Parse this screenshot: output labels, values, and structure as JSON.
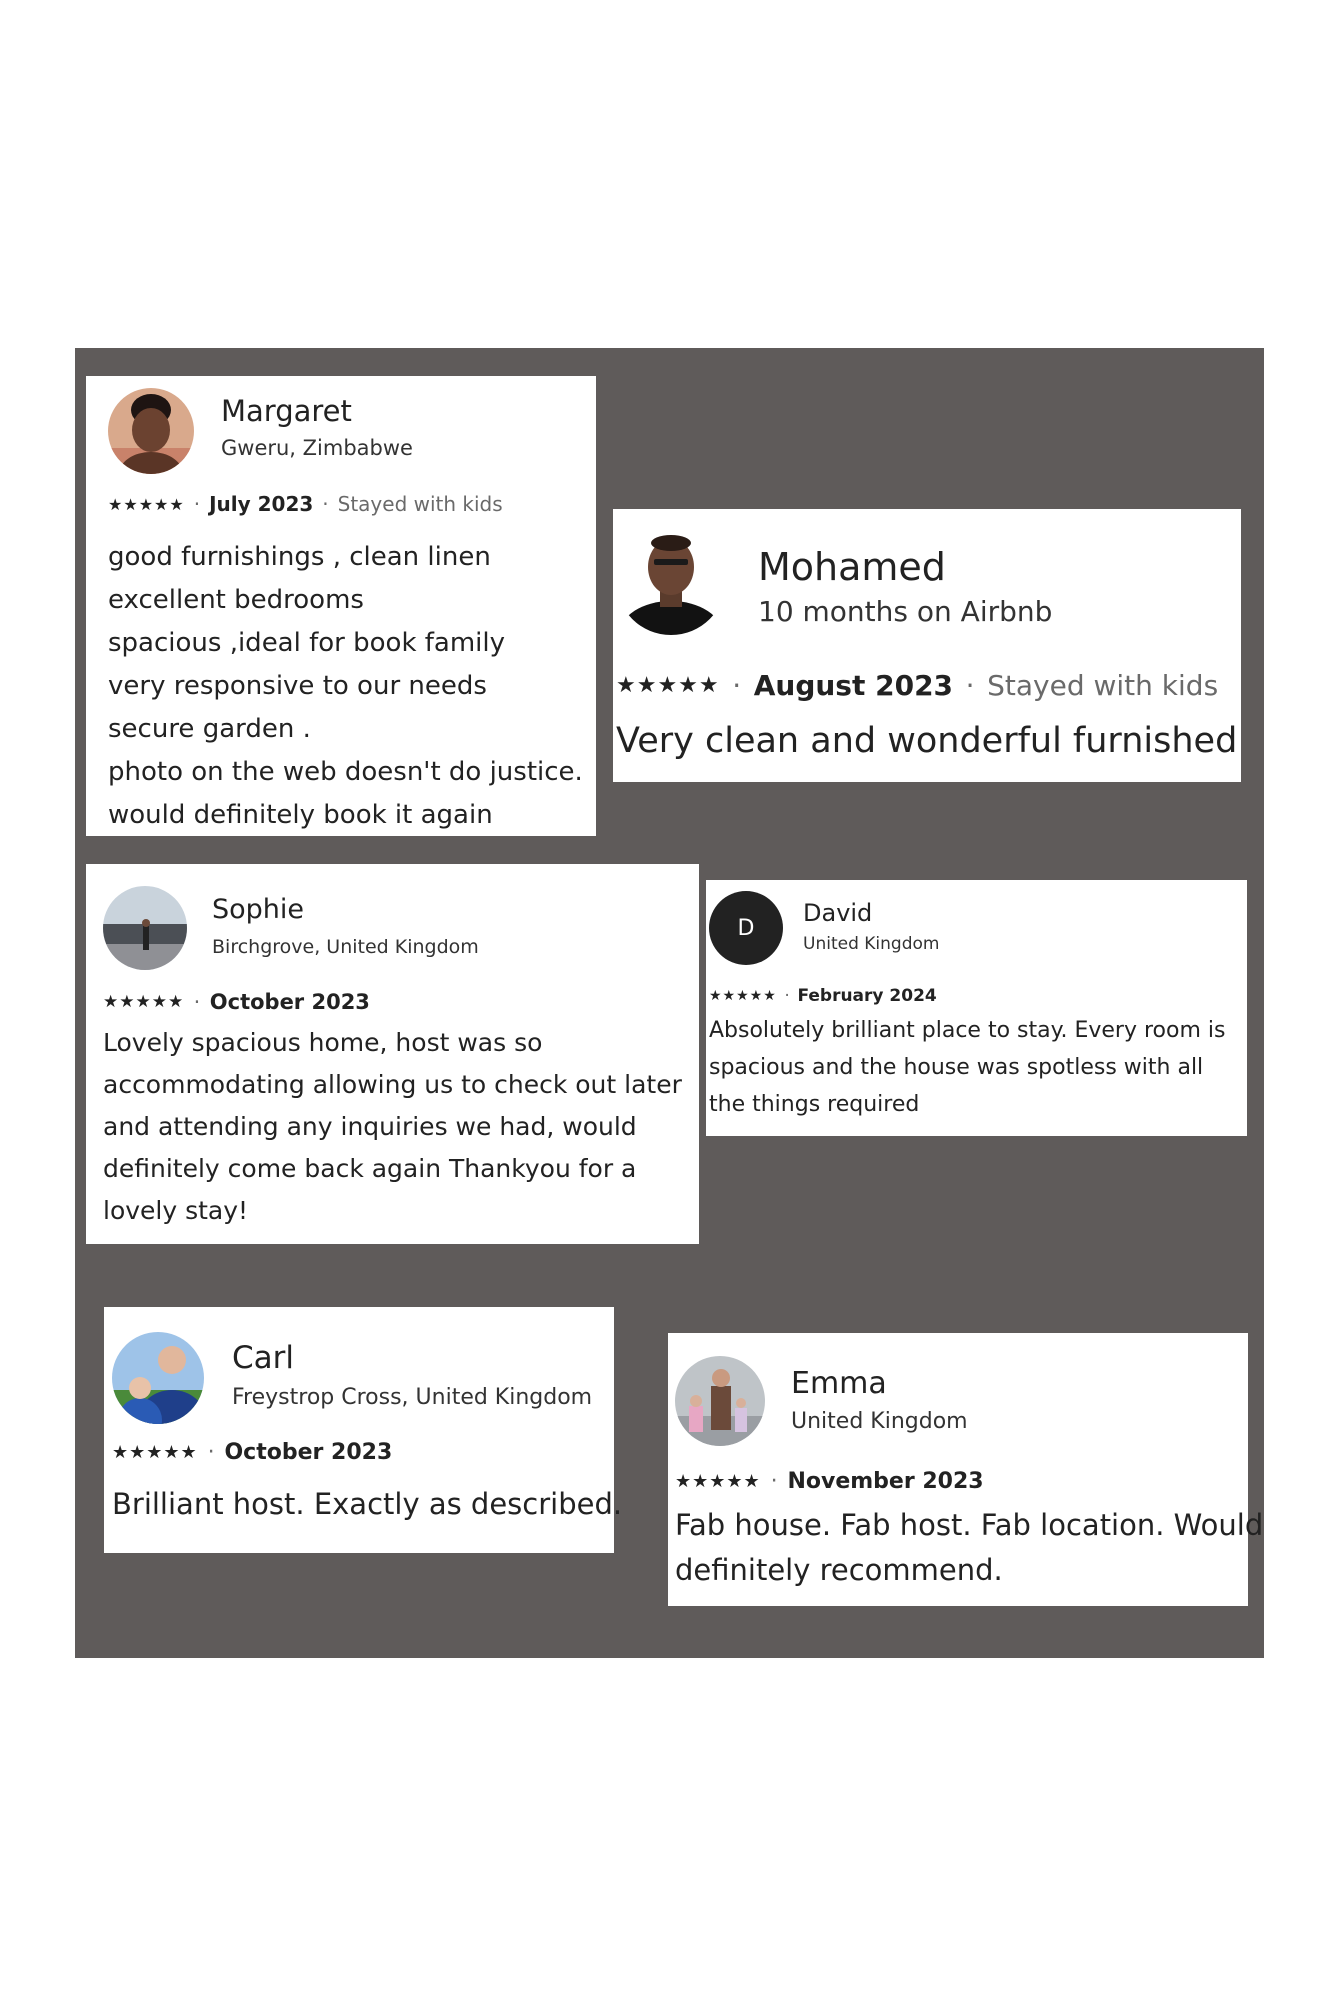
{
  "reviews": [
    {
      "name": "Margaret",
      "location": "Gweru, Zimbabwe",
      "stars": "★★★★★",
      "date": "July 2023",
      "trip": "Stayed with kids",
      "avatar_icon": "person-photo-icon",
      "lines": [
        "good furnishings , clean linen",
        "excellent bedrooms",
        "spacious ,ideal for book family",
        "very responsive to our needs",
        "secure garden .",
        "photo on the web doesn't do justice.",
        "would definitely book it again"
      ]
    },
    {
      "name": "Mohamed",
      "location": "10 months on Airbnb",
      "stars": "★★★★★",
      "date": "August 2023",
      "trip": "Stayed with kids",
      "avatar_icon": "person-photo-icon",
      "text": "Very clean and wonderful furnished"
    },
    {
      "name": "Sophie",
      "location": "Birchgrove, United Kingdom",
      "stars": "★★★★★",
      "date": "October 2023",
      "avatar_icon": "landscape-photo-icon",
      "lines": [
        "Lovely spacious home, host was so",
        "accommodating allowing us to check out later",
        "and attending any inquiries we had, would",
        "definitely come back again Thankyou for a",
        "lovely stay!"
      ]
    },
    {
      "name": "David",
      "location": "United Kingdom",
      "initial": "D",
      "stars": "★★★★★",
      "date": "February 2024",
      "lines": [
        "Absolutely brilliant place to stay. Every room is",
        "spacious and the house was spotless with all",
        "the things required"
      ]
    },
    {
      "name": "Carl",
      "location": "Freystrop Cross, United Kingdom",
      "stars": "★★★★★",
      "date": "October 2023",
      "avatar_icon": "person-photo-icon",
      "text": "Brilliant host. Exactly as described."
    },
    {
      "name": "Emma",
      "location": "United Kingdom",
      "stars": "★★★★★",
      "date": "November 2023",
      "avatar_icon": "person-photo-icon",
      "lines": [
        "Fab house. Fab host. Fab location. Would",
        "definitely recommend."
      ]
    }
  ],
  "colors": {
    "board": "#5f5b5a",
    "card": "#ffffff",
    "text": "#222222",
    "muted": "#6a6a6a"
  }
}
